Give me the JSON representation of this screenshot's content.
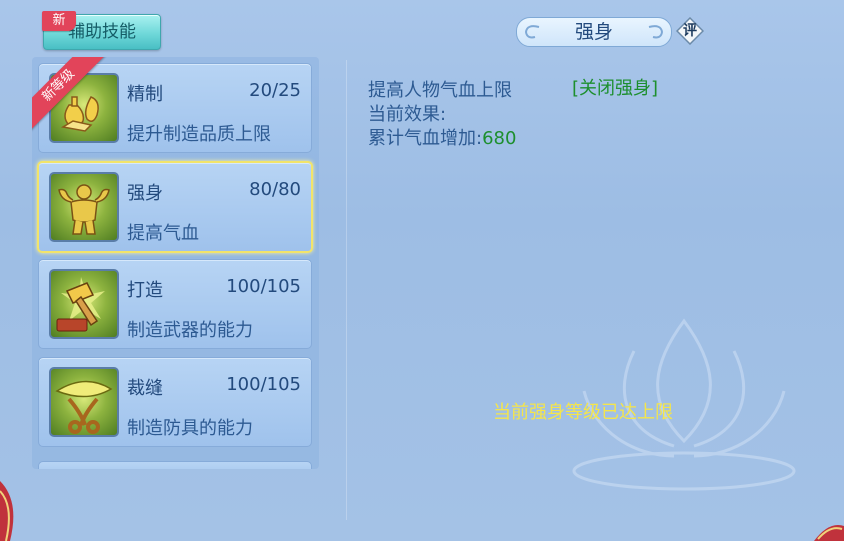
{
  "tab": {
    "label": "辅助技能",
    "badge": "新"
  },
  "skills": [
    {
      "name": "精制",
      "level": "20/25",
      "desc": "提升制造品质上限",
      "ribbon": "新等级",
      "icon": "refine-icon"
    },
    {
      "name": "强身",
      "level": "80/80",
      "desc": "提高气血",
      "icon": "strength-icon",
      "selected": true
    },
    {
      "name": "打造",
      "level": "100/105",
      "desc": "制造武器的能力",
      "icon": "hammer-icon"
    },
    {
      "name": "裁缝",
      "level": "100/105",
      "desc": "制造防具的能力",
      "icon": "scissors-icon"
    }
  ],
  "detail": {
    "title": "强身",
    "rate_label": "评",
    "line1": "提高人物气血上限",
    "close_link": "[关闭强身]",
    "line2": "当前效果:",
    "line3_label": "累计气血增加:",
    "line3_value": "680",
    "max_message": "当前强身等级已达上限"
  },
  "colors": {
    "accent_green": "#1d8f2e",
    "highlight_yellow": "#f4e54b",
    "badge_red": "#e2445a"
  }
}
